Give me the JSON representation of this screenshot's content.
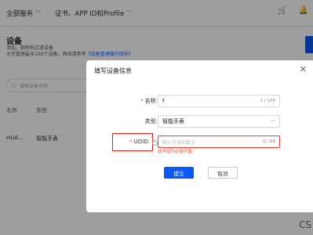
{
  "topbar": {
    "items": [
      {
        "label": "全部服务"
      },
      {
        "label": "证书、APP ID和Profile"
      }
    ],
    "icons": [
      "cart-icon",
      "bell-icon"
    ]
  },
  "page": {
    "title": "设备",
    "desc_line1": "添加、删除和过滤设备",
    "desc_line2_prefix": "允许管理最多100个设备。具体请参考",
    "desc_link": "《设备管理操作指导》"
  },
  "search": {
    "placeholder": "搜索设备名称"
  },
  "table": {
    "headers": [
      "名称",
      "类型"
    ],
    "rows": [
      {
        "name": "HUA...",
        "type": "智能手表"
      }
    ]
  },
  "dialog": {
    "title": "填写设备信息",
    "name_label": "名称:",
    "name_value": "f",
    "name_counter": "1 / 100",
    "type_label": "类型:",
    "type_value": "智能手表",
    "udid_label": "UDID:",
    "udid_placeholder": "输入字母和数字",
    "udid_counter": "0 / 64",
    "udid_error": "此字段为必填字段。",
    "submit_label": "提交",
    "cancel_label": "取消"
  },
  "footer_text": "CS"
}
